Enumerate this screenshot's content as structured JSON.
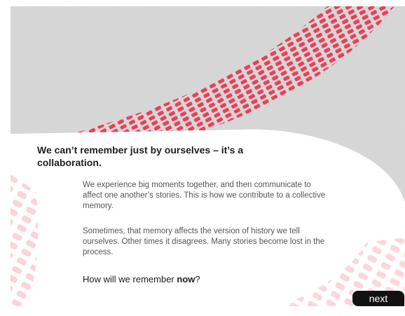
{
  "content": {
    "headline": "We can’t remember just by ourselves – it’s a collaboration.",
    "paragraph_1": "We experience big moments together, and then communicate to affect one another’s stories. This is how we contribute to a collective memory.",
    "paragraph_2": "Sometimes, that memory affects the version of history we tell ourselves. Other times it disagrees. Many stories become lost in the process.",
    "question_prefix": "How will we remember ",
    "question_emphasis": "now",
    "question_suffix": "?"
  },
  "navigation": {
    "next_label": "next"
  },
  "colors": {
    "accent": "#f03c55",
    "accent_faded": "#fbd3d8",
    "background_texture": "#d8d8d8",
    "button": "#111111"
  }
}
